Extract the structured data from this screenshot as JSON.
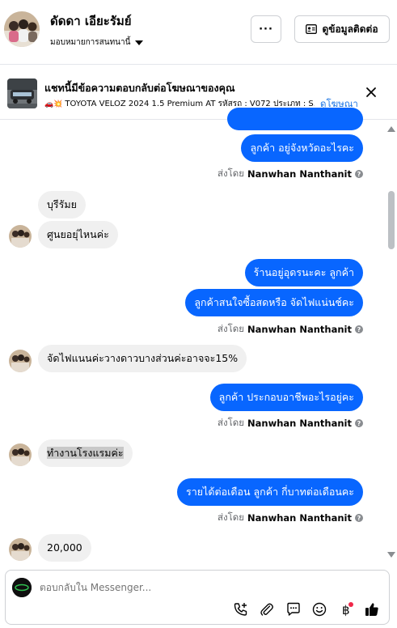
{
  "header": {
    "contact_name": "ดัดดา เอียะรัมย์",
    "assign_label": "มอบหมายการสนทนานี้",
    "more_label": "···",
    "info_label": "ดูข้อมูลติดต่อ"
  },
  "ad": {
    "title": "แชทนี้มีข้อความตอบกลับต่อโฆษณาของคุณ",
    "subtitle": "TOYOTA VELOZ 2024 1.5 Premium AT รหัสรถ : V072 ประเภท : S...",
    "subtitle_emoji": "🚗💥",
    "view_ad_label": "ดูโฆษณา"
  },
  "conversation": {
    "sent_by_prefix": "ส่งโดย",
    "agent_name": "Nanwhan Nanthanit",
    "messages": [
      {
        "side": "out",
        "text": "ลูกค้า อยู่จังหวัดอะไรคะ"
      },
      {
        "side": "in",
        "text": "บุรีรัมย"
      },
      {
        "side": "in",
        "text": "ศูนยอยุ่ไหนค่ะ"
      },
      {
        "side": "out",
        "text": "ร้านอยู่อุดรนะคะ  ลูกค้า"
      },
      {
        "side": "out",
        "text": "ลูกค้าสนใจซื้อสดหรือ จัดไฟแน่นช์คะ"
      },
      {
        "side": "in",
        "text": "จัดไฟแนนค่ะวางดาวบางส่วนค่ะอาจจะ15%"
      },
      {
        "side": "out",
        "text": "ลูกค้า ประกอบอาชีพอะไรอยู่คะ"
      },
      {
        "side": "in",
        "text": "ทำงานโรงแรมค่ะ"
      },
      {
        "side": "out",
        "text": "รายได้ต่อเดือน  ลูกค้า กี่บาทต่อเดือนคะ"
      },
      {
        "side": "in",
        "text": "20,000"
      }
    ]
  },
  "composer": {
    "placeholder": "ตอบกลับใน Messenger..."
  },
  "icons": [
    "more-icon",
    "contact-card-icon",
    "close-icon",
    "chevron-down-icon",
    "call-add-icon",
    "attachment-icon",
    "saved-reply-icon",
    "emoji-icon",
    "baht-icon",
    "like-icon"
  ],
  "colors": {
    "outgoing_bubble": "#0866ff",
    "incoming_bubble": "#f0f0f0",
    "link": "#1b74e4",
    "notification_dot": "#f02849"
  }
}
